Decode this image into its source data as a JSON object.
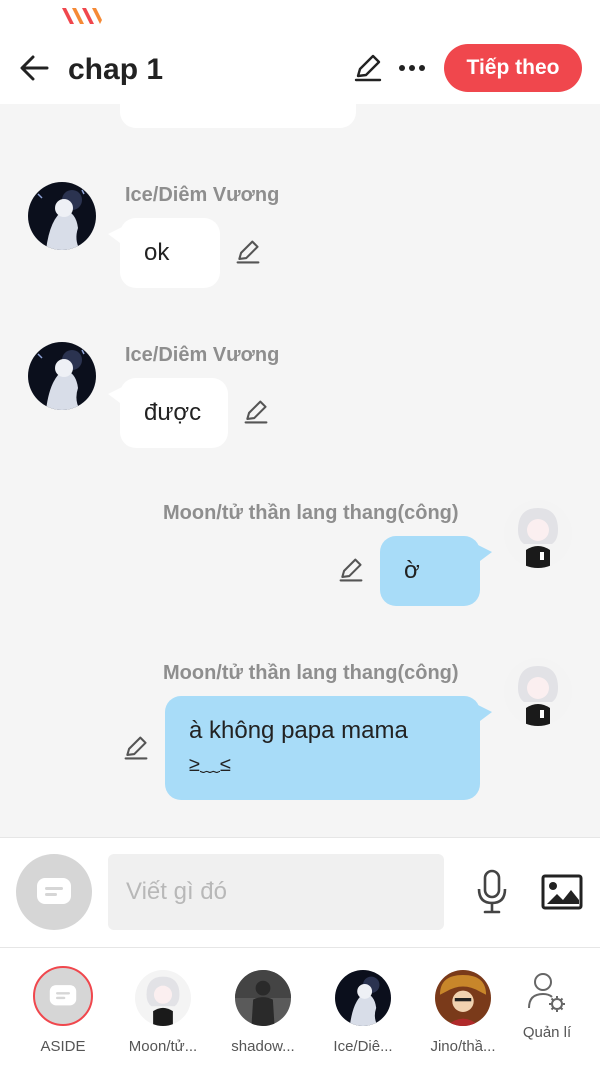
{
  "header": {
    "title": "chap 1",
    "next_label": "Tiếp theo"
  },
  "messages": [
    {
      "side": "left",
      "sender": "Ice/Diêm Vương",
      "text": "ok"
    },
    {
      "side": "left",
      "sender": "Ice/Diêm Vương",
      "text": "được"
    },
    {
      "side": "right",
      "sender": "Moon/tử thần lang thang(công)",
      "text": "ờ"
    },
    {
      "side": "right",
      "sender": "Moon/tử thần lang thang(công)",
      "text_line1": "à không papa mama",
      "text_line2": "≥﹏≤"
    }
  ],
  "composer": {
    "placeholder": "Viết gì đó"
  },
  "characters": [
    {
      "label": "ASIDE"
    },
    {
      "label": "Moon/tử..."
    },
    {
      "label": "shadow..."
    },
    {
      "label": "Ice/Diê..."
    },
    {
      "label": "Jino/thầ..."
    }
  ],
  "manage_label": "Quản lí",
  "colors": {
    "accent": "#f0474d",
    "bubble_right": "#a8dcf8",
    "bubble_left": "#ffffff",
    "name_gray": "#8e8e8e",
    "background": "#f5f5f5"
  },
  "icons": [
    "carrier-logo",
    "back-arrow-icon",
    "pencil-icon",
    "more-dots-icon",
    "chat-bubble-icon",
    "microphone-icon",
    "image-icon",
    "person-gear-icon"
  ]
}
